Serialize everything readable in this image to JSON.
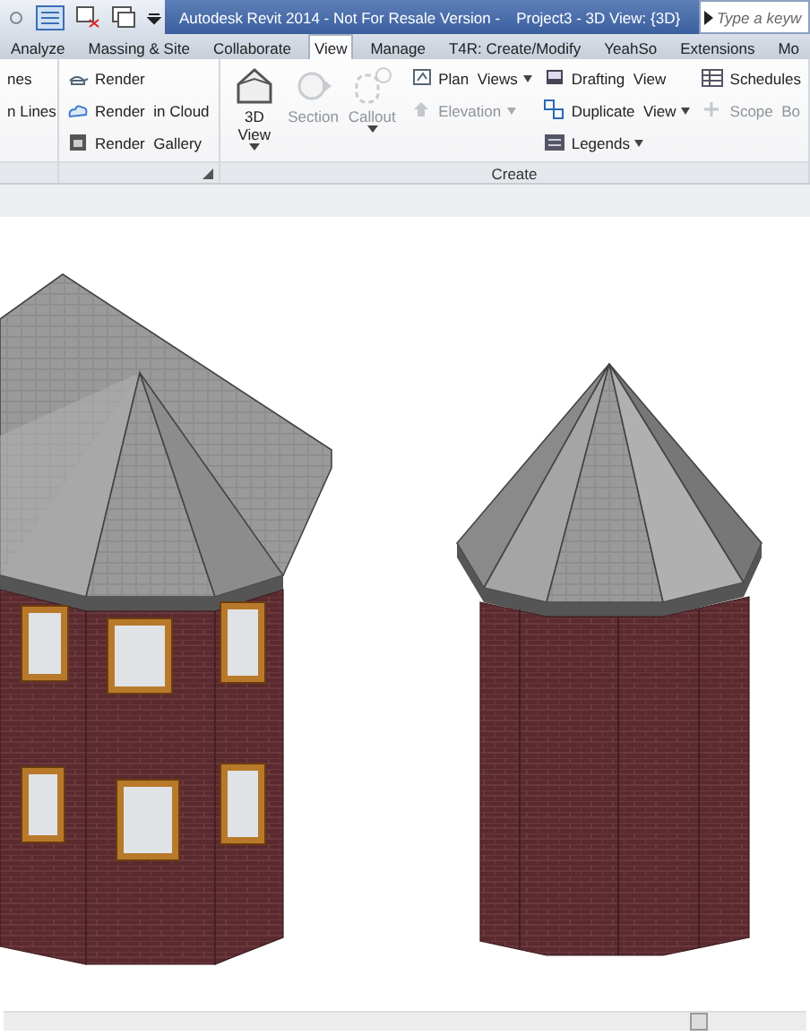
{
  "title_bar": {
    "title": "Autodesk Revit 2014 - Not For Resale Version -",
    "document": "Project3 - 3D View: {3D}",
    "search": {
      "placeholder": "Type a keyw"
    }
  },
  "tabs": [
    {
      "label": "Analyze",
      "selected": false
    },
    {
      "label": "Massing & Site",
      "selected": false
    },
    {
      "label": "Collaborate",
      "selected": false
    },
    {
      "label": "View",
      "selected": true
    },
    {
      "label": "Manage",
      "selected": false
    },
    {
      "label": "T4R: Create/Modify",
      "selected": false
    },
    {
      "label": "YeahSo",
      "selected": false
    },
    {
      "label": "Extensions",
      "selected": false
    },
    {
      "label": "Mo",
      "selected": false
    }
  ],
  "ribbon": {
    "partial_panel": {
      "items": [
        {
          "label": "nes"
        },
        {
          "label": "n Lines"
        }
      ]
    },
    "render_panel": {
      "items": [
        {
          "label": "Render"
        },
        {
          "label": "Render  in Cloud"
        },
        {
          "label": "Render  Gallery"
        }
      ]
    },
    "create_panel": {
      "title": "Create",
      "large_buttons": [
        {
          "label": "3D",
          "label_2": "View",
          "disabled": false,
          "dropdown": true
        },
        {
          "label": "Section",
          "disabled": true,
          "dropdown": false
        },
        {
          "label": "Callout",
          "disabled": true,
          "dropdown": true
        }
      ],
      "columns": [
        [
          {
            "label": "Plan  Views",
            "disabled": false,
            "dropdown": true
          },
          {
            "label": "Elevation",
            "disabled": true,
            "dropdown": true
          }
        ],
        [
          {
            "label": "Drafting  View",
            "disabled": false,
            "dropdown": false
          },
          {
            "label": "Duplicate  View",
            "disabled": false,
            "dropdown": true
          },
          {
            "label": "Legends",
            "disabled": false,
            "dropdown": true
          }
        ],
        [
          {
            "label": "Schedules",
            "disabled": false,
            "dropdown": false
          },
          {
            "label": "Scope  Bo",
            "disabled": true,
            "dropdown": false
          }
        ]
      ]
    }
  }
}
